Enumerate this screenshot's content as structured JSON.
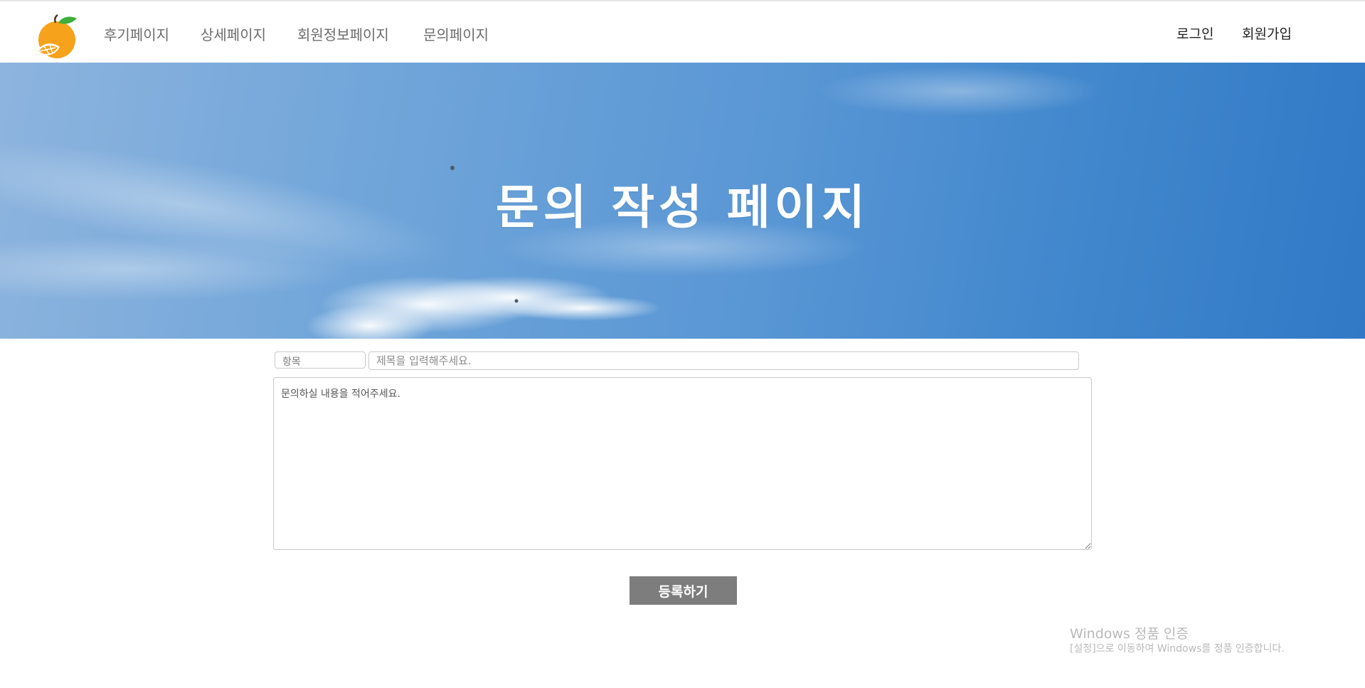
{
  "nav": {
    "logo_alt": "orange-logo",
    "links": [
      {
        "label": "후기페이지"
      },
      {
        "label": "상세페이지"
      },
      {
        "label": "회원정보페이지"
      },
      {
        "label": "문의페이지"
      }
    ],
    "login_label": "로그인",
    "signup_label": "회원가입"
  },
  "hero": {
    "title": "문의 작성 페이지"
  },
  "form": {
    "category_placeholder": "항목",
    "title_placeholder": "제목을 입력해주세요.",
    "content_placeholder": "문의하실 내용을 적어주세요.",
    "submit_label": "등록하기"
  },
  "watermark": {
    "title": "Windows 정품 인증",
    "subtitle": "[설정]으로 이동하여 Windows를 정품 인증합니다."
  },
  "colors": {
    "logo_orange": "#f7a21b",
    "leaf_green": "#3fae3a",
    "sky_blue": "#4a8ed2",
    "button_gray": "#7d7d7d"
  }
}
